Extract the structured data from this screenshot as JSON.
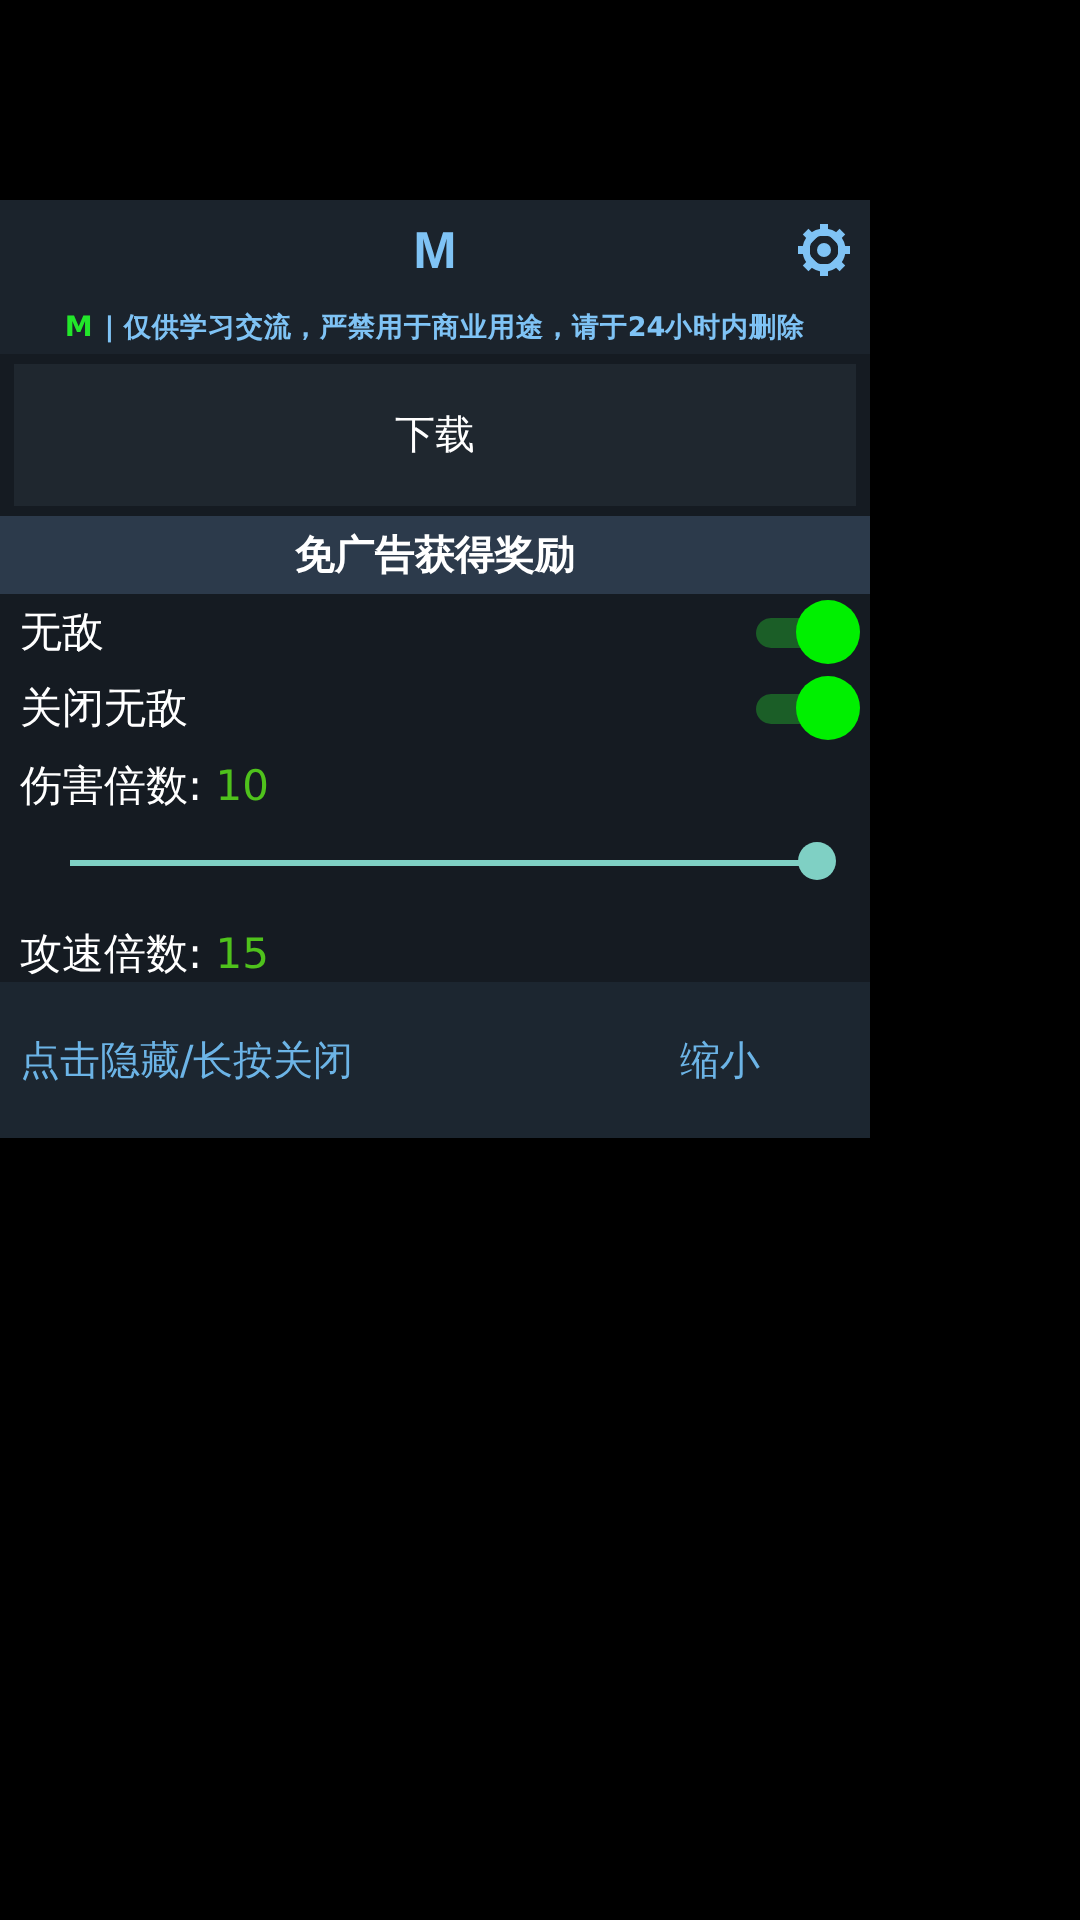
{
  "header": {
    "title": "M"
  },
  "notice": {
    "tag": "M",
    "text": "| 仅供学习交流，严禁用于商业用途，请于24小时内删除"
  },
  "download_button": {
    "label": "下载"
  },
  "section": {
    "title": "免广告获得奖励"
  },
  "items": [
    {
      "kind": "toggle",
      "label": "无敌",
      "on": true
    },
    {
      "kind": "toggle",
      "label": "关闭无敌",
      "on": true
    },
    {
      "kind": "slider",
      "label": "伤害倍数:",
      "value": "10",
      "level": 1
    },
    {
      "kind": "slider",
      "label": "攻速倍数:",
      "value": "15"
    }
  ],
  "footer": {
    "hide_link": "点击隐藏/长按关闭",
    "shrink_button": "缩小"
  }
}
